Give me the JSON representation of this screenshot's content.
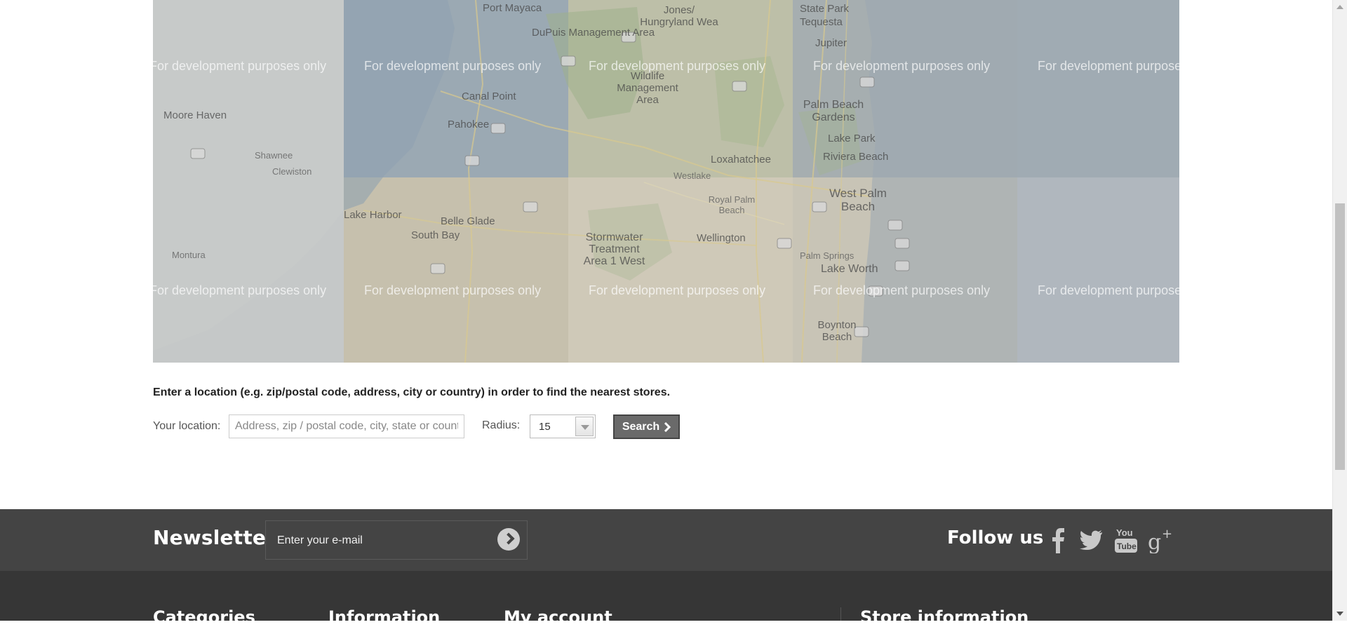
{
  "map": {
    "watermark": "For development purposes only",
    "labels": [
      "Port Mayaca",
      "DuPuis Management Area",
      "Jones/ Hungryland Wea",
      "State Park",
      "Tequesta",
      "Jupiter",
      "Wildlife Management Area",
      "Canal Point",
      "Palm Beach Gardens",
      "Moore Haven",
      "Pahokee",
      "Lake Park",
      "Riviera Beach",
      "Shawnee",
      "Clewiston",
      "Loxahatchee",
      "Westlake",
      "West Palm Beach",
      "Royal Palm Beach",
      "Lake Harbor",
      "Belle Glade",
      "South Bay",
      "Stormwater Treatment Area 1 West",
      "Wellington",
      "Palm Springs",
      "Lake Worth",
      "Montura",
      "Boynton Beach"
    ]
  },
  "store_locator": {
    "instructions": "Enter a location (e.g. zip/postal code, address, city or country) in order to find the nearest stores.",
    "location_label": "Your location:",
    "location_placeholder": "Address, zip / postal code, city, state or country",
    "radius_label": "Radius:",
    "radius_value": "15",
    "search_label": "Search"
  },
  "footer": {
    "newsletter_title": "Newsletter",
    "newsletter_placeholder": "Enter your e-mail",
    "follow_title": "Follow us",
    "social": [
      {
        "name": "facebook-icon"
      },
      {
        "name": "twitter-icon"
      },
      {
        "name": "youtube-icon"
      },
      {
        "name": "google-plus-icon"
      }
    ],
    "columns": [
      "Categories",
      "Information",
      "My account",
      "Store information"
    ]
  },
  "colors": {
    "footer_top": "#444444",
    "footer_bottom": "#363636",
    "search_button": "#6a6a6a"
  }
}
